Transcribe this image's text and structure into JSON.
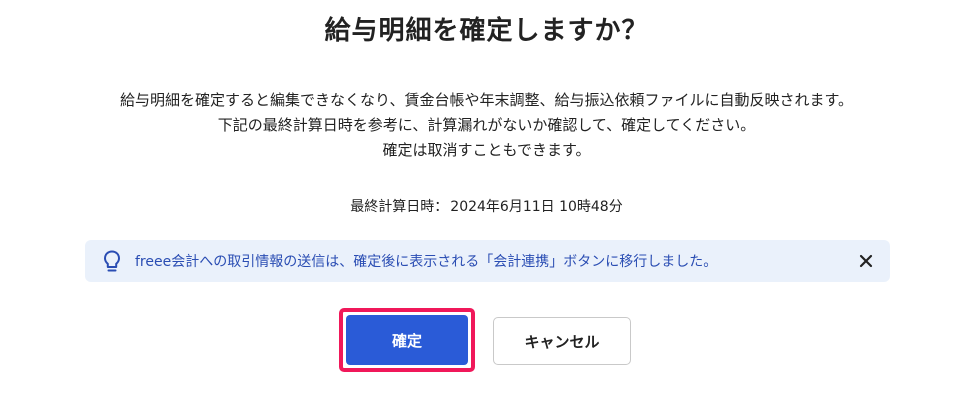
{
  "dialog": {
    "title": "給与明細を確定しますか？",
    "description": [
      "給与明細を確定すると編集できなくなり、賃金台帳や年末調整、給与振込依頼ファイルに自動反映されます。",
      "下記の最終計算日時を参考に、計算漏れがないか確認して、確定してください。",
      "確定は取消すこともできます。"
    ],
    "last_calc_label": "最終計算日時：",
    "last_calc_value": "2024年6月11日 10時48分",
    "notice": {
      "icon": "lightbulb-icon",
      "text": "freee会計への取引情報の送信は、確定後に表示される「会計連携」ボタンに移行しました。",
      "close_icon": "close-icon"
    },
    "buttons": {
      "confirm_label": "確定",
      "cancel_label": "キャンセル"
    }
  },
  "colors": {
    "primary": "#2a5bd7",
    "highlight": "#f0185a",
    "notice_bg": "#eaf1fb",
    "notice_text": "#2a4db3"
  }
}
